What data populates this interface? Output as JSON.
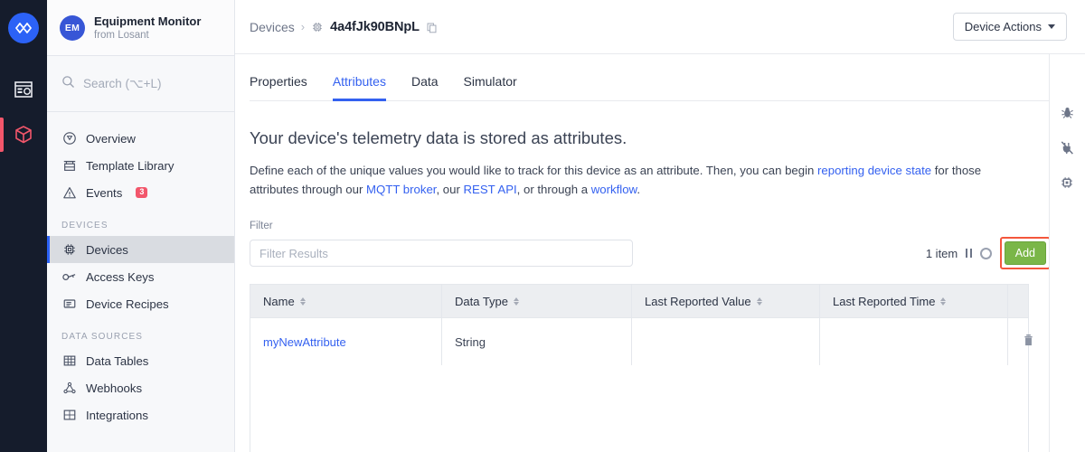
{
  "rail": {
    "logo": "losant-logo-icon",
    "items": [
      {
        "name": "dashboards-icon",
        "active": false
      },
      {
        "name": "devices-cube-icon",
        "active": true
      }
    ],
    "active_color": "#f2566b",
    "logo_color": "#2c62f6"
  },
  "sidebar": {
    "workspace": {
      "avatar": "EM",
      "name": "Equipment Monitor",
      "subtitle": "from Losant"
    },
    "search": {
      "placeholder": "Search (⌥+L)"
    },
    "nav": [
      {
        "label": "Overview",
        "icon": "overview-icon"
      },
      {
        "label": "Template Library",
        "icon": "template-library-icon"
      },
      {
        "label": "Events",
        "icon": "events-warning-icon",
        "badge": "3"
      }
    ],
    "groups": [
      {
        "label": "DEVICES",
        "items": [
          {
            "label": "Devices",
            "icon": "chip-icon",
            "active": true
          },
          {
            "label": "Access Keys",
            "icon": "key-icon"
          },
          {
            "label": "Device Recipes",
            "icon": "recipe-icon"
          }
        ]
      },
      {
        "label": "DATA SOURCES",
        "items": [
          {
            "label": "Data Tables",
            "icon": "table-icon"
          },
          {
            "label": "Webhooks",
            "icon": "webhook-icon"
          },
          {
            "label": "Integrations",
            "icon": "integrations-icon"
          }
        ]
      }
    ]
  },
  "topbar": {
    "breadcrumb_root": "Devices",
    "breadcrumb_separator": "›",
    "device_icon": "chip-icon",
    "device_id": "4a4fJk90BNpL",
    "copy_icon": "copy-icon",
    "device_actions_label": "Device Actions"
  },
  "tabs": [
    {
      "label": "Properties",
      "active": false
    },
    {
      "label": "Attributes",
      "active": true
    },
    {
      "label": "Data",
      "active": false
    },
    {
      "label": "Simulator",
      "active": false
    }
  ],
  "page": {
    "heading": "Your device's telemetry data is stored as attributes.",
    "body_part1": "Define each of the unique values you would like to track for this device as an attribute. Then, you can begin ",
    "link_reporting": "reporting device state",
    "body_part2": " for those attributes through our ",
    "link_mqtt": "MQTT broker",
    "body_part3": ", our ",
    "link_rest": "REST API",
    "body_part4": ", or through a ",
    "link_workflow": "workflow",
    "body_part5": "."
  },
  "filter": {
    "label": "Filter",
    "placeholder": "Filter Results",
    "value": "",
    "item_count": "1 item",
    "pause_icon": "pause-icon",
    "refresh_icon": "spinner-icon",
    "add_label": "Add",
    "add_color": "#7ab648",
    "highlight_color": "#f4563c"
  },
  "table": {
    "columns": [
      "Name",
      "Data Type",
      "Last Reported Value",
      "Last Reported Time"
    ],
    "rows": [
      {
        "name": "myNewAttribute",
        "data_type": "String",
        "last_reported_value": "",
        "last_reported_time": "",
        "delete_icon": "trash-icon"
      }
    ]
  },
  "right_rail": [
    {
      "name": "bug-icon"
    },
    {
      "name": "disconnected-plug-icon"
    },
    {
      "name": "device-chip-icon"
    }
  ]
}
